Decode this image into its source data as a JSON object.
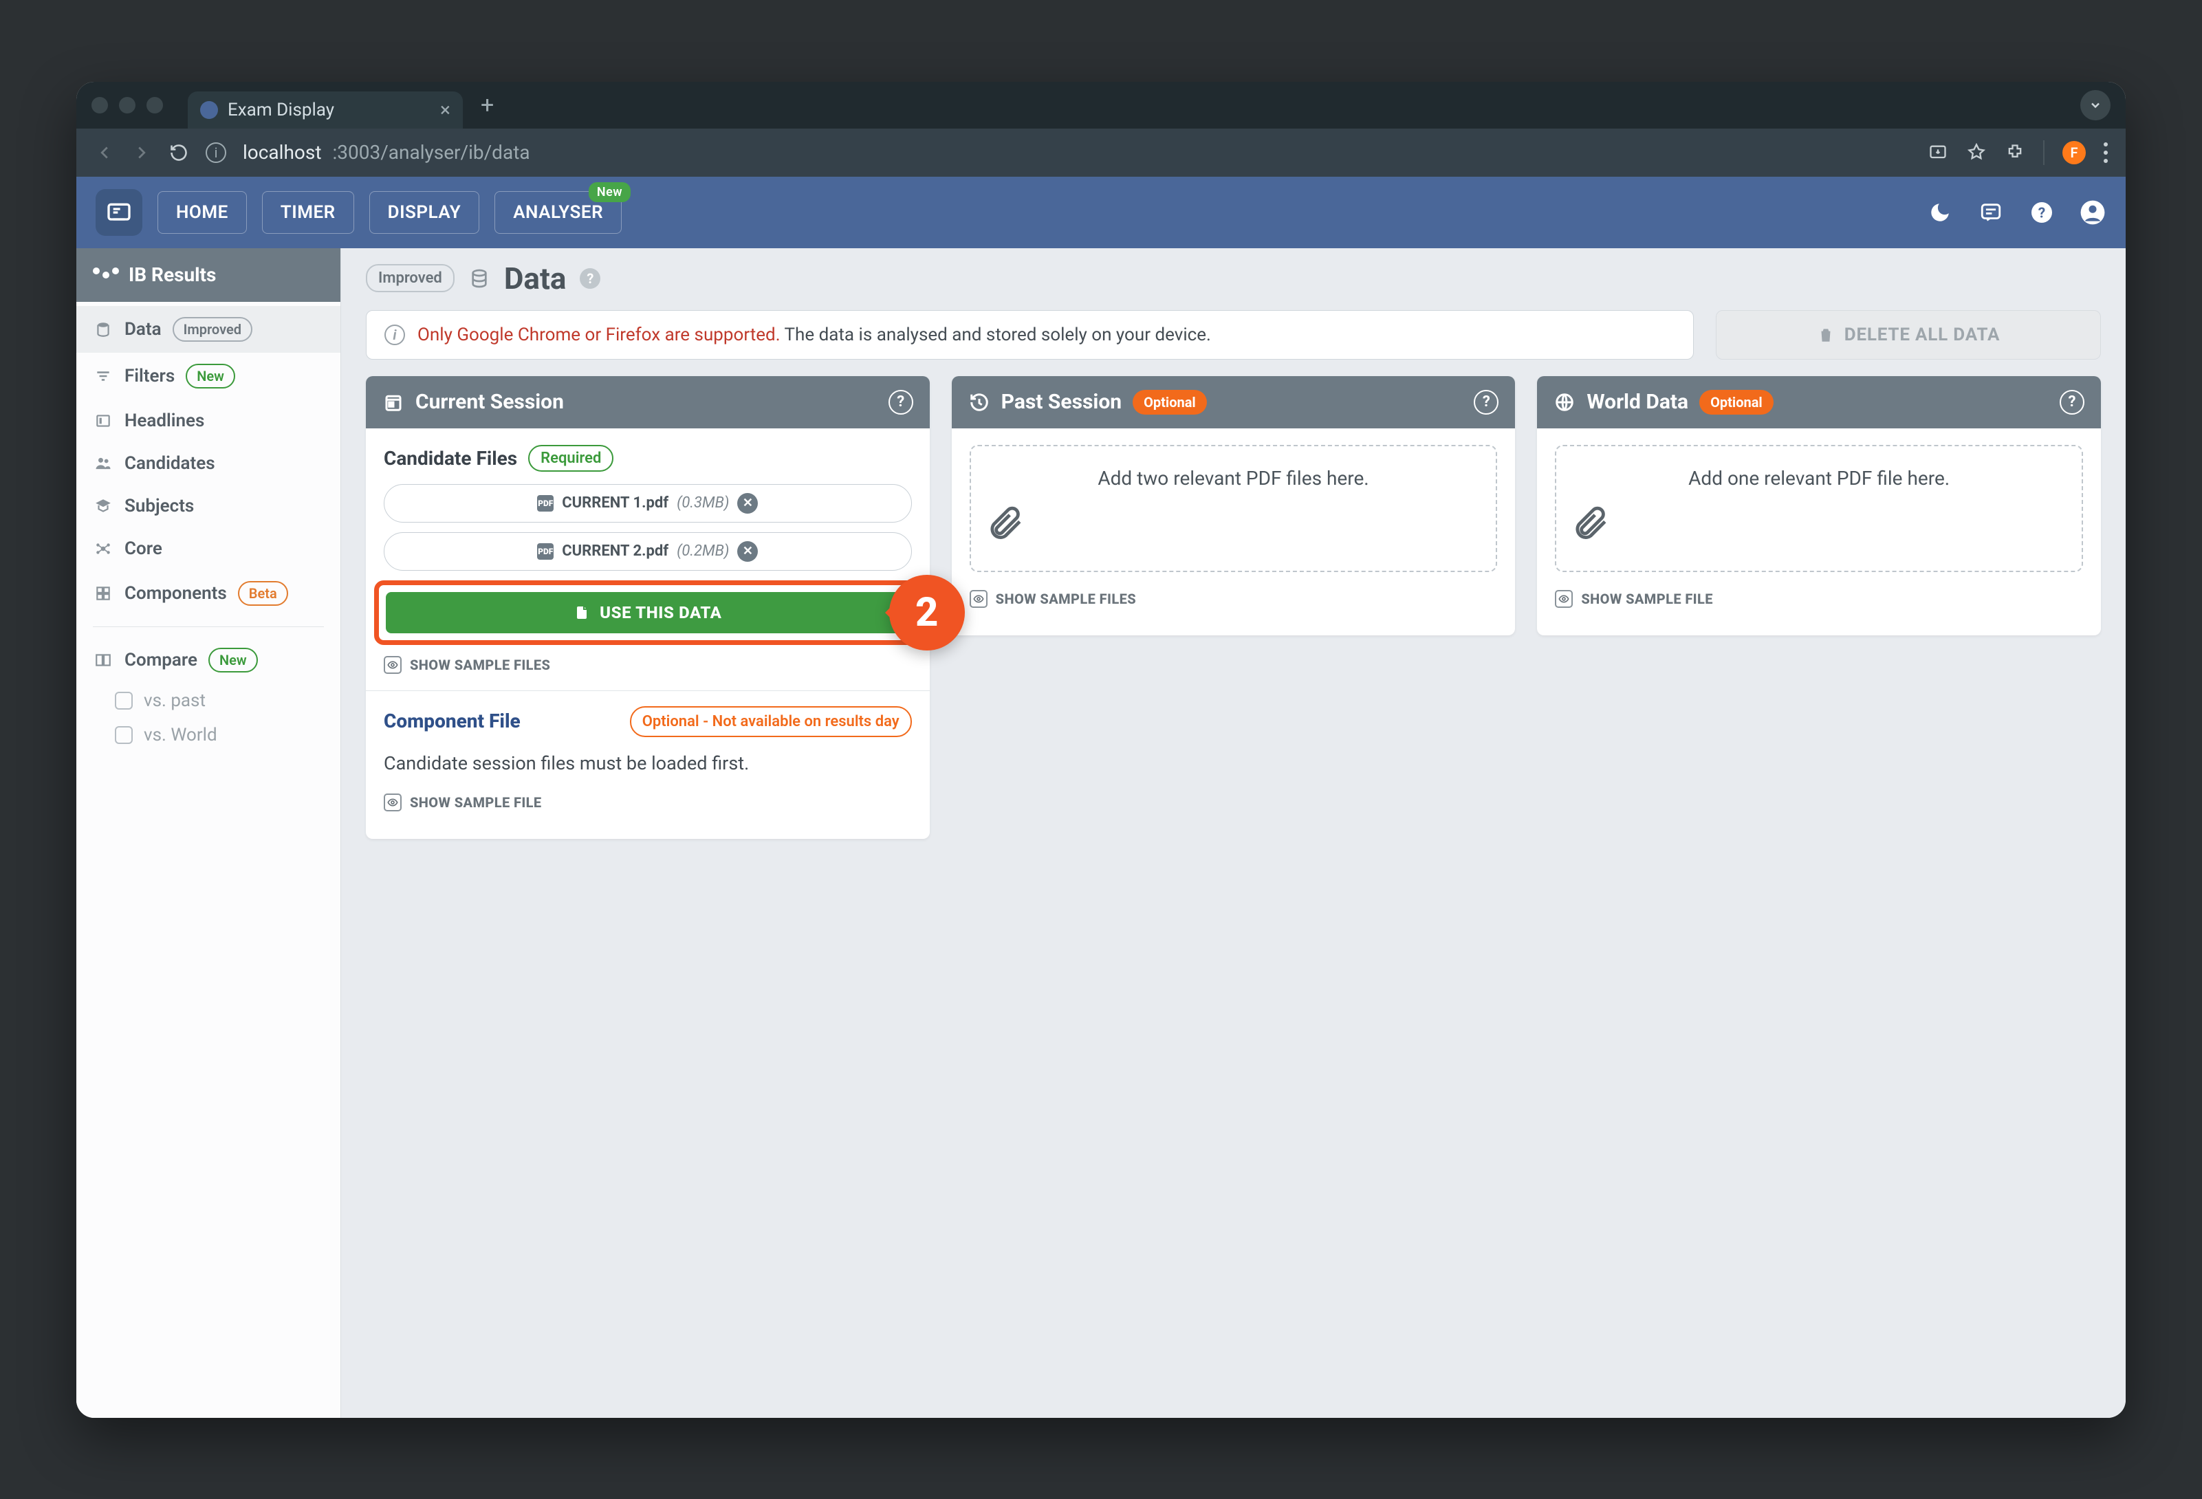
{
  "browser": {
    "tab_title": "Exam Display",
    "url_host": "localhost",
    "url_port_path": ":3003/analyser/ib/data",
    "avatar_letter": "F"
  },
  "nav": {
    "items": [
      "HOME",
      "TIMER",
      "DISPLAY",
      "ANALYSER"
    ],
    "analyser_badge": "New"
  },
  "sidebar": {
    "title": "IB Results",
    "items": [
      {
        "label": "Data",
        "badge": "Improved"
      },
      {
        "label": "Filters",
        "badge": "New"
      },
      {
        "label": "Headlines"
      },
      {
        "label": "Candidates"
      },
      {
        "label": "Subjects"
      },
      {
        "label": "Core"
      },
      {
        "label": "Components",
        "badge": "Beta"
      }
    ],
    "compare": {
      "label": "Compare",
      "badge": "New",
      "sub": [
        "vs. past",
        "vs. World"
      ]
    }
  },
  "page": {
    "badge": "Improved",
    "title": "Data",
    "alert_warn": "Only Google Chrome or Firefox are supported.",
    "alert_rest": " The data is analysed and stored solely on your device.",
    "delete_label": "DELETE ALL DATA"
  },
  "cards": {
    "current": {
      "title": "Current Session",
      "candidate_title": "Candidate Files",
      "required_pill": "Required",
      "files": [
        {
          "name": "CURRENT 1.pdf",
          "size": "(0.3MB)"
        },
        {
          "name": "CURRENT 2.pdf",
          "size": "(0.2MB)"
        }
      ],
      "use_btn": "USE THIS DATA",
      "step_badge": "2",
      "sample": "SHOW SAMPLE FILES",
      "component_title": "Component File",
      "component_pill": "Optional - Not available on results day",
      "component_note": "Candidate session files must be loaded first.",
      "component_sample": "SHOW SAMPLE FILE"
    },
    "past": {
      "title": "Past Session",
      "pill": "Optional",
      "drop_text": "Add two relevant PDF files here.",
      "sample": "SHOW SAMPLE FILES"
    },
    "world": {
      "title": "World Data",
      "pill": "Optional",
      "drop_text": "Add one relevant PDF file here.",
      "sample": "SHOW SAMPLE FILE"
    }
  }
}
